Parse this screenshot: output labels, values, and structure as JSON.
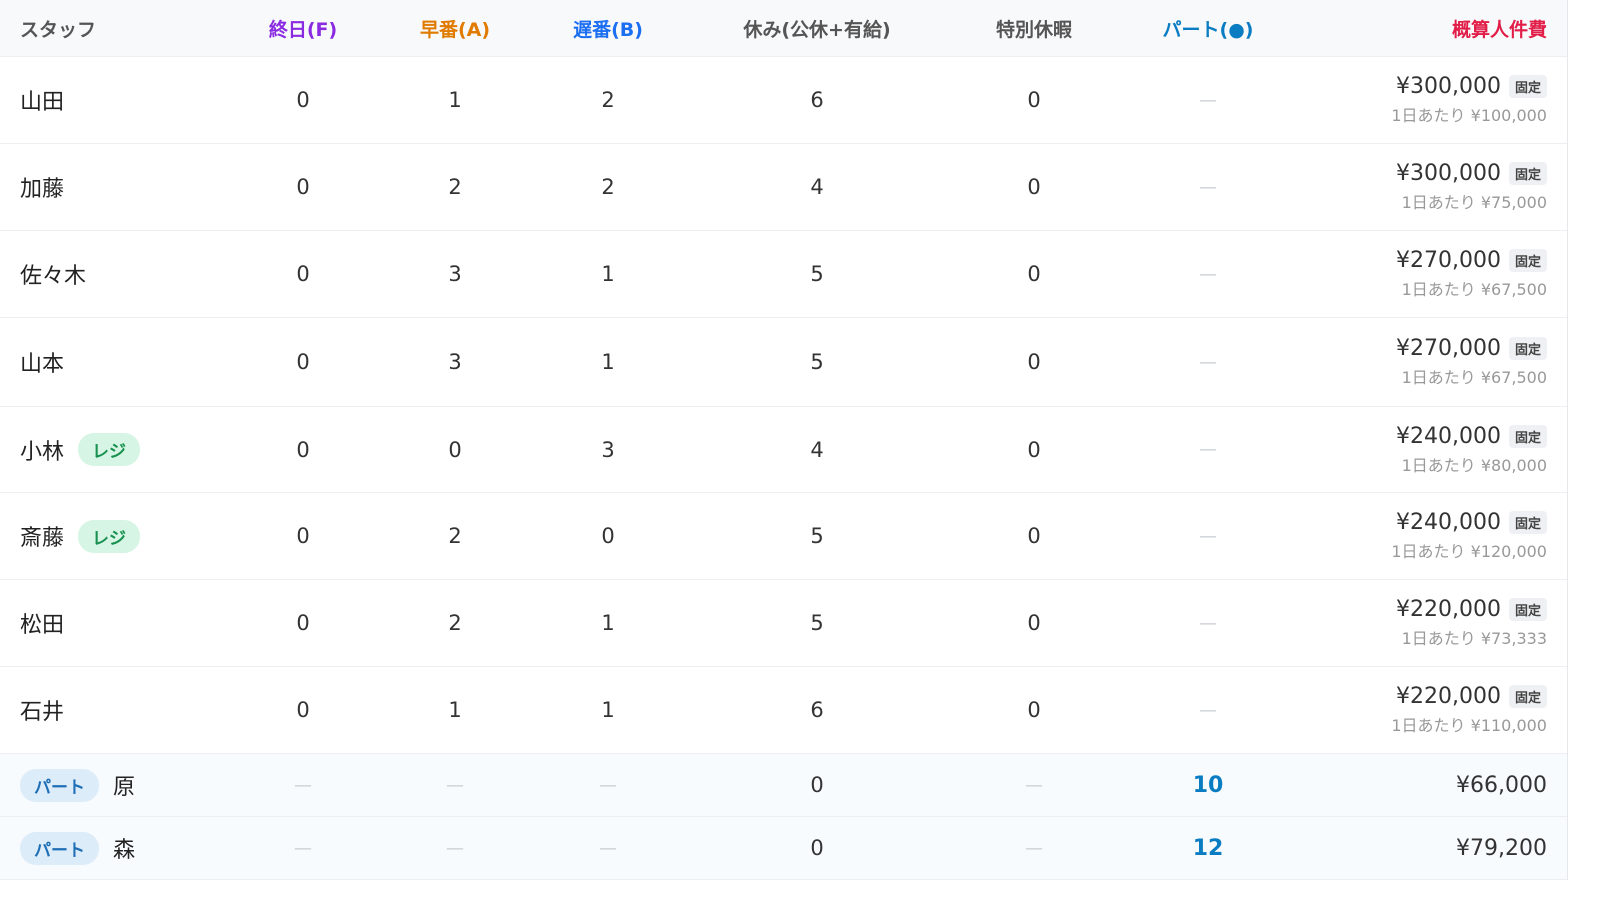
{
  "columns": {
    "staff": "スタッフ",
    "full": "終日(F)",
    "early": "早番(A)",
    "late": "遅番(B)",
    "off": "休み(公休+有給)",
    "special": "特別休暇",
    "part": "パート(●)",
    "cost": "概算人件費"
  },
  "colors": {
    "full": "#8a2be2",
    "early": "#e07b00",
    "late": "#1d6ff2",
    "off": "#555555",
    "special": "#555555",
    "part": "#0a7cc2",
    "cost": "#e11d48"
  },
  "dash": "—",
  "fixed_label": "固定",
  "staff": [
    {
      "name": "山田",
      "tag": "",
      "full": "0",
      "early": "1",
      "late": "2",
      "off": "6",
      "special": "0",
      "part": "—",
      "cost": "¥300,000",
      "per_day": "1日あたり ¥100,000"
    },
    {
      "name": "加藤",
      "tag": "",
      "full": "0",
      "early": "2",
      "late": "2",
      "off": "4",
      "special": "0",
      "part": "—",
      "cost": "¥300,000",
      "per_day": "1日あたり ¥75,000"
    },
    {
      "name": "佐々木",
      "tag": "",
      "full": "0",
      "early": "3",
      "late": "1",
      "off": "5",
      "special": "0",
      "part": "—",
      "cost": "¥270,000",
      "per_day": "1日あたり ¥67,500"
    },
    {
      "name": "山本",
      "tag": "",
      "full": "0",
      "early": "3",
      "late": "1",
      "off": "5",
      "special": "0",
      "part": "—",
      "cost": "¥270,000",
      "per_day": "1日あたり ¥67,500"
    },
    {
      "name": "小林",
      "tag": "レジ",
      "full": "0",
      "early": "0",
      "late": "3",
      "off": "4",
      "special": "0",
      "part": "—",
      "cost": "¥240,000",
      "per_day": "1日あたり ¥80,000"
    },
    {
      "name": "斎藤",
      "tag": "レジ",
      "full": "0",
      "early": "2",
      "late": "0",
      "off": "5",
      "special": "0",
      "part": "—",
      "cost": "¥240,000",
      "per_day": "1日あたり ¥120,000"
    },
    {
      "name": "松田",
      "tag": "",
      "full": "0",
      "early": "2",
      "late": "1",
      "off": "5",
      "special": "0",
      "part": "—",
      "cost": "¥220,000",
      "per_day": "1日あたり ¥73,333"
    },
    {
      "name": "石井",
      "tag": "",
      "full": "0",
      "early": "1",
      "late": "1",
      "off": "6",
      "special": "0",
      "part": "—",
      "cost": "¥220,000",
      "per_day": "1日あたり ¥110,000"
    }
  ],
  "parts": [
    {
      "tag": "パート",
      "name": "原",
      "full": "—",
      "early": "—",
      "late": "—",
      "off": "0",
      "special": "—",
      "part": "10",
      "cost": "¥66,000"
    },
    {
      "tag": "パート",
      "name": "森",
      "full": "—",
      "early": "—",
      "late": "—",
      "off": "0",
      "special": "—",
      "part": "12",
      "cost": "¥79,200"
    }
  ]
}
